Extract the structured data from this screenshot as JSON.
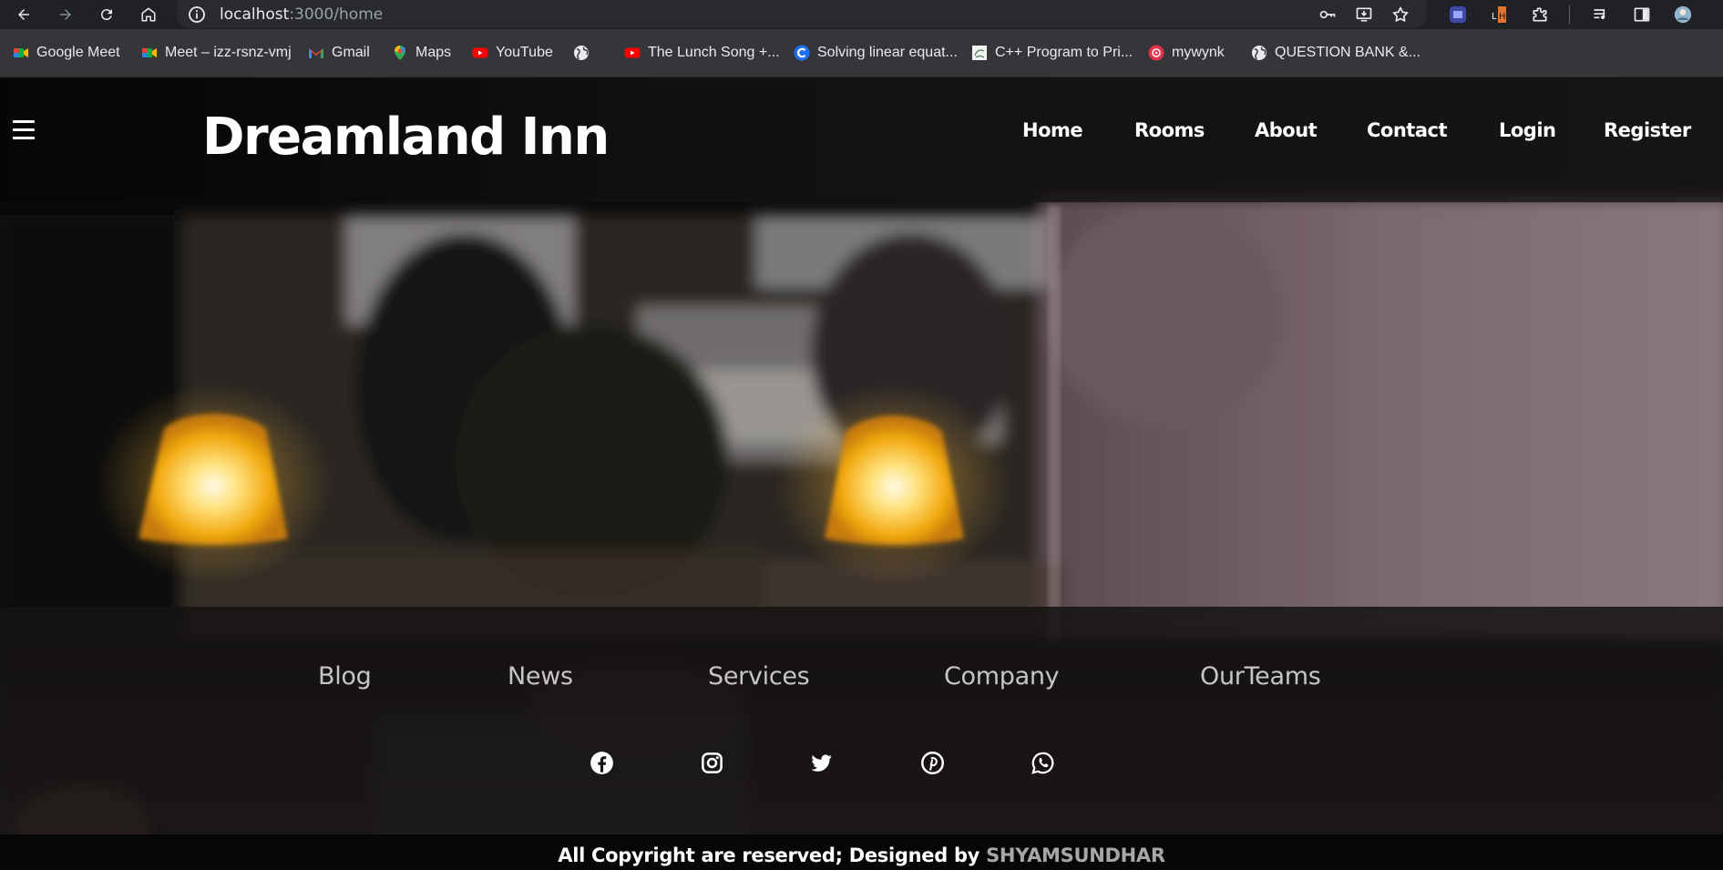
{
  "browser": {
    "url_host": "localhost",
    "url_path": ":3000/home",
    "bookmarks": [
      {
        "label": "Google Meet",
        "icon": "google-meet-icon"
      },
      {
        "label": "Meet – izz-rsnz-vmj",
        "icon": "google-meet-icon"
      },
      {
        "label": "Gmail",
        "icon": "gmail-icon"
      },
      {
        "label": "Maps",
        "icon": "maps-icon"
      },
      {
        "label": "YouTube",
        "icon": "youtube-icon"
      },
      {
        "label": "",
        "icon": "globe-icon"
      },
      {
        "label": "The Lunch Song +...",
        "icon": "youtube-icon"
      },
      {
        "label": "Solving linear equat...",
        "icon": "c-logo-icon"
      },
      {
        "label": "C++ Program to Pri...",
        "icon": "site-icon"
      },
      {
        "label": "mywynk",
        "icon": "wynk-icon"
      },
      {
        "label": "QUESTION BANK &...",
        "icon": "globe-icon"
      }
    ]
  },
  "site": {
    "brand": "Dreamland Inn",
    "nav": [
      "Home",
      "Rooms",
      "About",
      "Contact",
      "Login",
      "Register"
    ],
    "footer_links": [
      "Blog",
      "News",
      "Services",
      "Company",
      "OurTeams"
    ],
    "social": [
      "facebook-icon",
      "instagram-icon",
      "twitter-icon",
      "pinterest-icon",
      "whatsapp-icon"
    ],
    "copyright_text": "All Copyright are reserved; Designed by ",
    "copyright_author": "SHYAMSUNDHAR"
  },
  "colors": {
    "chrome_bg": "#202124",
    "bookmarks_bg": "#35363a",
    "footer_link": "#c7c4c4",
    "author": "#a9a6a6",
    "lamp": "#f5b820"
  }
}
